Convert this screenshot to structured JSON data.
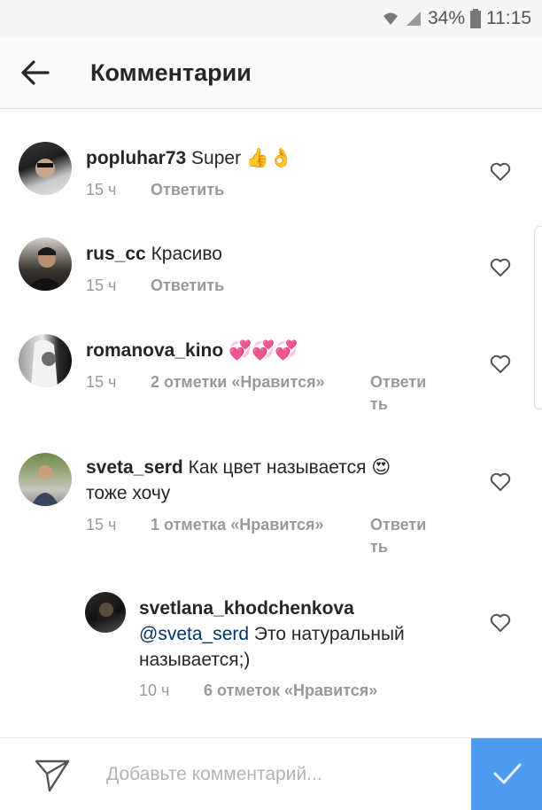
{
  "status_bar": {
    "battery": "34%",
    "time": "11:15"
  },
  "header": {
    "title": "Комментарии"
  },
  "comments": [
    {
      "username": "popluhar73",
      "text": "Super",
      "emoji": "👍👌",
      "time": "15 ч",
      "reply": "Ответить"
    },
    {
      "username": "rus_cc",
      "text": "Красиво",
      "time": "15 ч",
      "reply": "Ответить"
    },
    {
      "username": "romanova_kino",
      "emoji": "💞💞💞",
      "time": "15 ч",
      "likes": "2 отметки «Нравится»",
      "reply_l1": "Ответи",
      "reply_l2": "ть"
    },
    {
      "username": "sveta_serd",
      "text": "Как цвет называется",
      "emoji": "😍",
      "text_line2": "тоже хочу",
      "time": "15 ч",
      "likes": "1 отметка «Нравится»",
      "reply_l1": "Ответи",
      "reply_l2": "ть"
    },
    {
      "username": "svetlana_khodchenkova",
      "mention": "@sveta_serd",
      "text": "Это натуральный",
      "text_line2": "называется;)",
      "time": "10 ч",
      "likes": "6 отметок «Нравится»"
    }
  ],
  "composer": {
    "placeholder": "Добавьте комментарий..."
  },
  "colors": {
    "post_button": "#4e9cf0",
    "mention": "#003569"
  }
}
